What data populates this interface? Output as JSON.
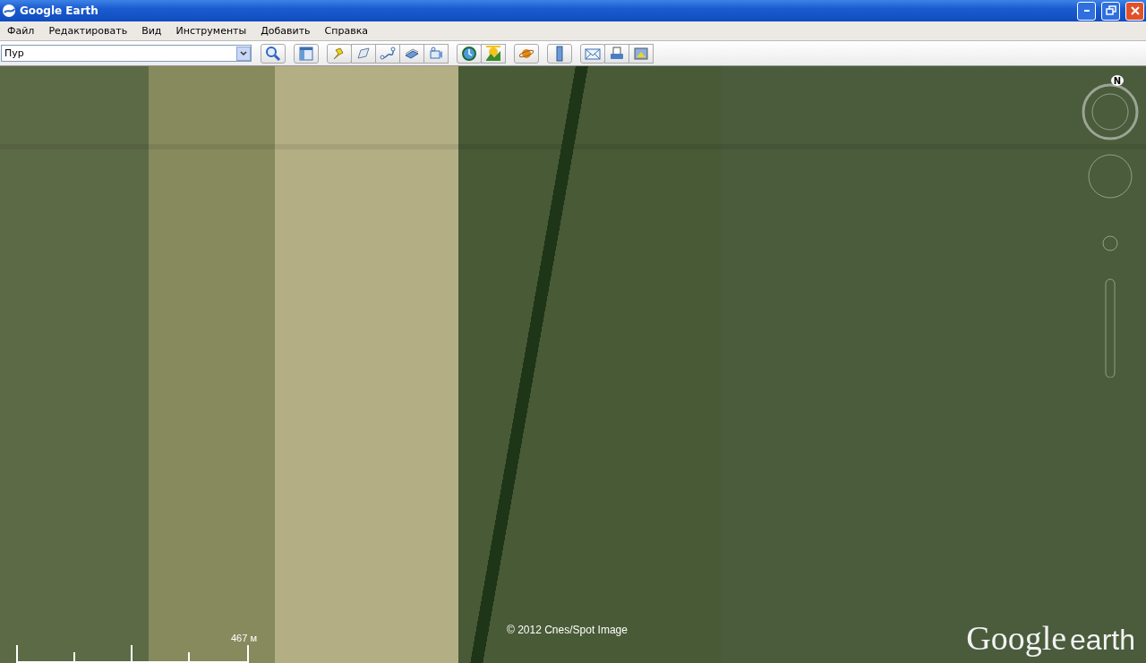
{
  "window": {
    "title": "Google Earth"
  },
  "menu": [
    "Файл",
    "Редактировать",
    "Вид",
    "Инструменты",
    "Добавить",
    "Справка"
  ],
  "search": {
    "value": "Пур"
  },
  "map": {
    "compass_label": "N",
    "scale_label": "467 м",
    "copyright": "© 2012 Cnes/Spot Image",
    "logo": {
      "word1": "Google",
      "word2": "earth"
    }
  }
}
